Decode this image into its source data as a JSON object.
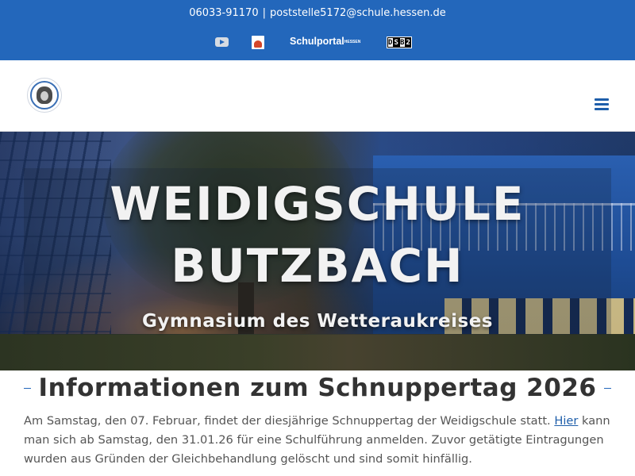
{
  "topbar": {
    "phone": "06033-91170",
    "separator": "|",
    "email": "poststelle5172@schule.hessen.de",
    "links": {
      "youtube_icon": "youtube-icon",
      "eagle_icon": "hessen-eagle-icon",
      "schulportal_label": "Schulportal",
      "schulportal_suffix": "HESSEN",
      "dsb_letters": [
        "D",
        "S",
        "B",
        "2"
      ]
    },
    "background": "#2367bb"
  },
  "header": {
    "logo_text": "Weidigschule Butzbach",
    "menu_icon": "hamburger-menu-icon"
  },
  "hero": {
    "title_line1": "WEIDIGSCHULE",
    "title_line2": "BUTZBACH",
    "subtitle": "Gymnasium des Wetteraukreises"
  },
  "article": {
    "title": "Informationen zum Schnuppertag 2026",
    "text_before_link": "Am Samstag, den 07. Februar, findet der diesjährige Schnuppertag der Weidigschule statt. ",
    "link_text": "Hier",
    "text_after_link": " kann man sich ab Samstag, den 31.01.26 für eine Schulführung anmelden. Zuvor getätigte Eintragungen wurden aus Gründen der Gleichbehandlung gelöscht und sind somit hinfällig."
  },
  "colors": {
    "primary": "#2367bb",
    "link": "#1e5eaa",
    "text": "#555555"
  }
}
